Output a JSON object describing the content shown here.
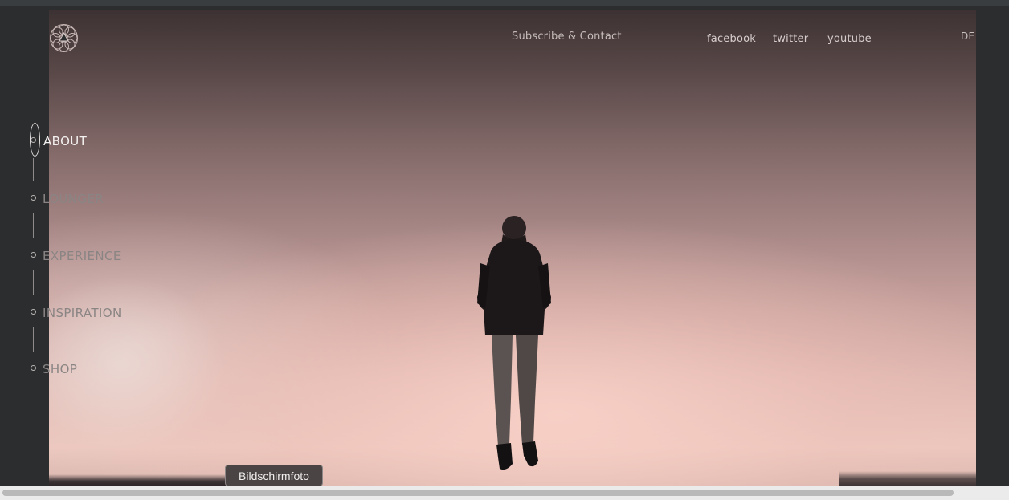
{
  "header": {
    "subscribe_label": "Subscribe & Contact",
    "social": {
      "facebook": "facebook",
      "twitter": "twitter",
      "youtube": "youtube"
    },
    "language": "DE",
    "logo_icon": "mandala-logo-icon"
  },
  "sidenav": {
    "items": [
      {
        "label": "ABOUT",
        "active": true
      },
      {
        "label": "LOUNGER",
        "active": false
      },
      {
        "label": "EXPERIENCE",
        "active": false
      },
      {
        "label": "INSPIRATION",
        "active": false
      },
      {
        "label": "SHOP",
        "active": false
      }
    ]
  },
  "tooltip": {
    "text": "Bildschirmfoto"
  },
  "colors": {
    "background": "#2b2d2f",
    "nav_active": "#f4f1f0",
    "nav_dim": "#8a8584",
    "sky_top": "#3d3233",
    "sky_bottom": "#ecc7be"
  }
}
